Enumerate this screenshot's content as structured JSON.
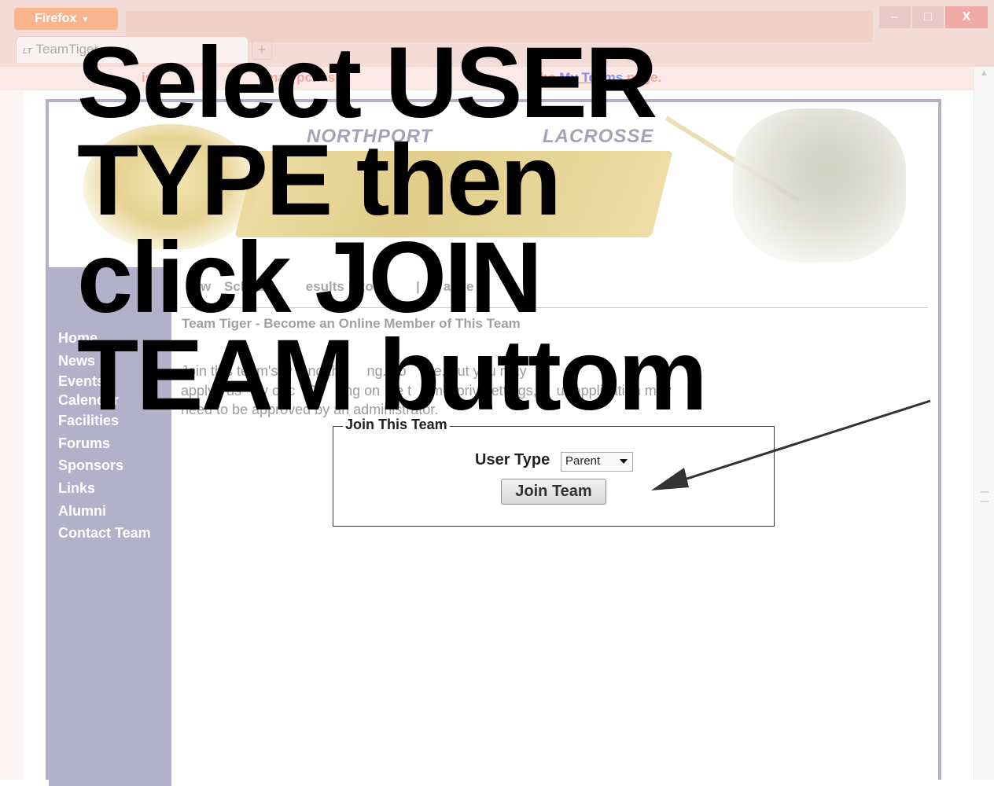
{
  "browser": {
    "menu_button": "Firefox",
    "tab_favicon": "LT",
    "tab_title": "TeamTiger",
    "new_tab": "+",
    "window_controls": {
      "minimize": "–",
      "maximize": "□",
      "close": "X"
    }
  },
  "notice": {
    "text_start": "is i",
    "text_mid_1": "ab",
    "text_mid_2": "may p",
    "text_mid_3": "chas",
    "text_mid_4": "y",
    "text_mid_5": "mo",
    "text_mid_6": "rv",
    "text_before_link": "the",
    "link": "My Teams",
    "text_after_link": "page."
  },
  "header": {
    "word_top_left": "NORTHPORT",
    "word_top_right": "LACROSSE"
  },
  "sidebar": {
    "items": [
      "Home",
      "News",
      "Events",
      "Calendar",
      "Facilities",
      "Forums",
      "Sponsors",
      "Links",
      "Alumni",
      "Contact Team"
    ]
  },
  "subnav": {
    "visible": [
      "w",
      "Sched",
      "esults",
      "Ros",
      "ache"
    ]
  },
  "content": {
    "heading": "Team Tiger - Become an Online Member of This Team",
    "intro_line1": "Join this team's w    ng the     ng. Yo     ne, but you may",
    "intro_line2": "apply   us     y onc   De     ng on    e t     m's priv   ettings,     ur application may",
    "intro_line3": "need to be approved by an administrator."
  },
  "join_form": {
    "legend": "Join This Team",
    "user_type_label": "User Type",
    "user_type_selected": "Parent",
    "button": "Join Team"
  },
  "overlay": {
    "line1": "Select USER",
    "line2": "TYPE then",
    "line3": "click JOIN",
    "line4": "TEAM buttom"
  },
  "colors": {
    "sidebar": "#b2b1c9",
    "frame_border": "#b2b1c9",
    "overlay_text": "#000000",
    "notice_text": "#f2a9a1",
    "link": "#8f8cf0"
  }
}
